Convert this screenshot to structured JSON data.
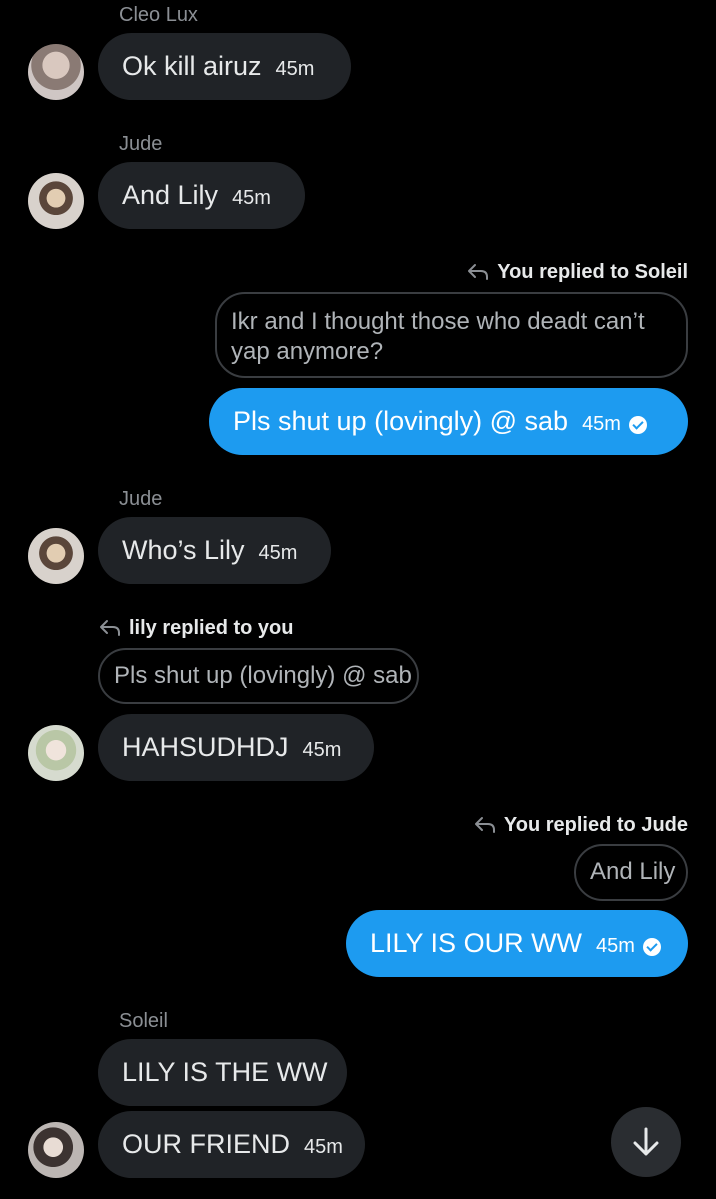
{
  "messages": {
    "m1": {
      "sender": "Cleo Lux",
      "text": "Ok kill airuz",
      "time": "45m"
    },
    "m2": {
      "sender": "Jude",
      "text": "And Lily",
      "time": "45m"
    },
    "m3": {
      "reply_label": "You replied to Soleil",
      "quoted": "Ikr and I thought those who deadt can’t yap anymore?",
      "text": "Pls shut up (lovingly) @ sab",
      "time": "45m"
    },
    "m4": {
      "sender": "Jude",
      "text": "Who’s Lily",
      "time": "45m"
    },
    "m5": {
      "reply_label": "lily replied to you",
      "quoted": "Pls shut up (lovingly) @ sab",
      "text": "HAHSUDHDJ",
      "time": "45m"
    },
    "m6": {
      "reply_label": "You replied to Jude",
      "quoted": "And Lily",
      "text": "LILY IS OUR WW",
      "time": "45m"
    },
    "m7": {
      "sender": "Soleil",
      "text": "LILY IS THE WW"
    },
    "m8": {
      "text": "OUR FRIEND",
      "time": "45m"
    }
  },
  "colors": {
    "background": "#000000",
    "incoming_bubble": "#202327",
    "outgoing_bubble": "#1d9bf0",
    "secondary_text": "#8b8f94"
  },
  "icons": {
    "reply": "reply-arrow-icon",
    "sent": "check-circle-icon",
    "scroll": "arrow-down-icon"
  }
}
